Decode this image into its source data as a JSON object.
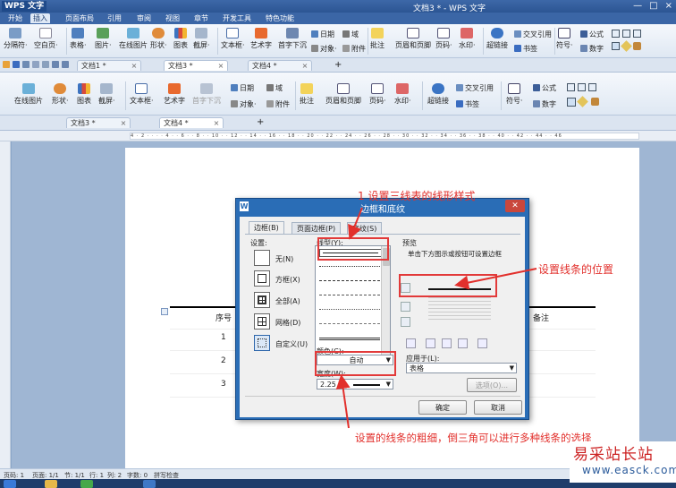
{
  "app": {
    "logo": "WPS 文字",
    "window_title": "文档3 * - WPS 文字",
    "window_buttons": [
      "—",
      "□",
      "×"
    ]
  },
  "menu_tabs": [
    "开始",
    "插入",
    "页面布局",
    "引用",
    "审阅",
    "视图",
    "章节",
    "开发工具",
    "特色功能"
  ],
  "ribbon1": {
    "items": [
      "分隔符·",
      "空白页·",
      "表格·",
      "图片·",
      "在线图片",
      "形状·",
      "图表",
      "截屏·",
      "文本框·",
      "艺术字",
      "首字下沉",
      "批注",
      "页眉和页脚",
      "页码·",
      "水印·",
      "超链接",
      "符号·"
    ],
    "small": [
      "日期",
      "域",
      "对象·",
      "附件",
      "交叉引用",
      "书签",
      "公式",
      "数字"
    ]
  },
  "doctabs1": [
    "文档1 *",
    "文档3 *",
    "文档4 *",
    "+"
  ],
  "ribbon2": {
    "items": [
      "在线图片",
      "形状·",
      "图表",
      "截屏·",
      "文本框·",
      "艺术字",
      "首字下沉",
      "批注",
      "页眉和页脚",
      "页码·",
      "水印·",
      "超链接",
      "符号·"
    ],
    "small": [
      "日期",
      "域",
      "对象·",
      "附件",
      "交叉引用",
      "书签",
      "公式",
      "数字"
    ]
  },
  "doctabs2": [
    "文档3 *",
    "文档4 *",
    "+"
  ],
  "ruler": "4 · 2 · · · · 4 · · 6 · · 8 · · 10 · · 12 · · 14 · · 16 · · 18 · · 20 · · 22 · · 24 · · 26 · · 28 · · 30 · · 32 · · 34 · · 36 · · 38 · · 40 · · 42 · · 44 · · 46",
  "table": {
    "headers": [
      "序号",
      "备注"
    ],
    "rows": [
      "1",
      "2",
      "3"
    ]
  },
  "dialog": {
    "title": "边框和底纹",
    "tabs": [
      "边框(B)",
      "页面边框(P)",
      "底纹(S)"
    ],
    "setting_label": "设置:",
    "presets": [
      "无(N)",
      "方框(X)",
      "全部(A)",
      "网格(D)",
      "自定义(U)"
    ],
    "style_label": "线型(Y):",
    "color_label": "颜色(C):",
    "color_value": "自动",
    "width_label": "宽度(W):",
    "width_value": "2.25 磅",
    "preview_label": "预览",
    "preview_hint": "单击下方图示或按钮可设置边框",
    "apply_label": "应用于(L):",
    "apply_value": "表格",
    "options_button": "选项(O)...",
    "ok_button": "确定",
    "cancel_button": "取消"
  },
  "annotations": {
    "step1": "1  设置三线表的线形样式",
    "position": "设置线条的位置",
    "width": "设置的线条的粗细，倒三角可以进行多种线条的选择"
  },
  "status_bar": [
    "页码: 1",
    "页面: 1/1",
    "节: 1/1",
    "行: 1",
    "列: 2",
    "字数: 0",
    "拼写检查"
  ],
  "watermark": {
    "site_name": "易采站长站",
    "url": "www.easck.com"
  },
  "colors": {
    "title_bar": "#2c5593",
    "dialog_frame": "#2a6db6",
    "annotation_red": "#e2302c"
  }
}
